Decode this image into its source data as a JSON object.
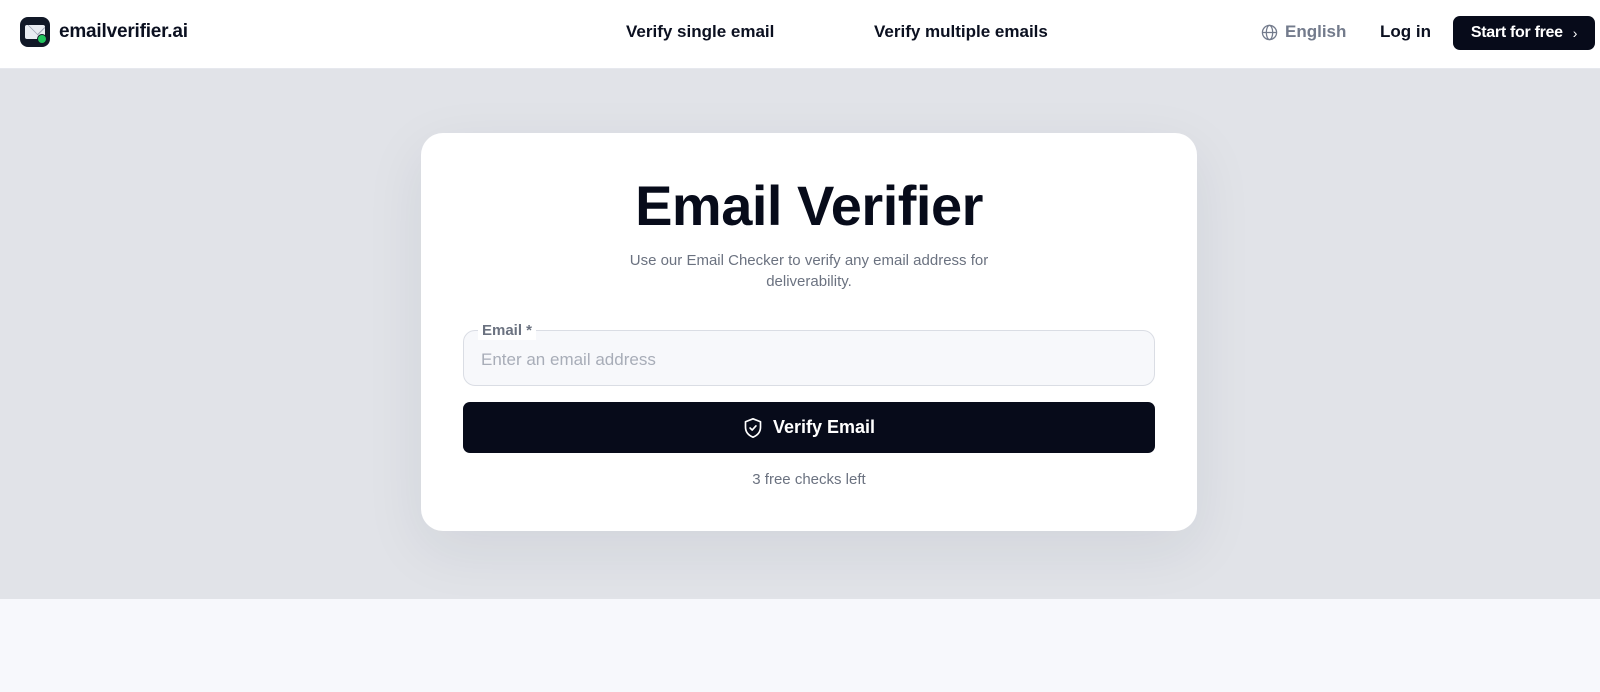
{
  "brand": {
    "name": "emailverifier.ai",
    "icon": "envelope-check-icon"
  },
  "nav": {
    "single": "Verify single email",
    "multiple": "Verify multiple emails"
  },
  "header": {
    "language": "English",
    "language_icon": "globe-icon",
    "login": "Log in",
    "cta": "Start for free",
    "cta_icon": "chevron-right-icon"
  },
  "card": {
    "title": "Email Verifier",
    "subtitle": "Use our Email Checker to verify any email address for deliverability.",
    "email_label": "Email *",
    "email_placeholder": "Enter an email address",
    "email_value": "",
    "button_label": "Verify Email",
    "button_icon": "shield-check-icon",
    "checks_left": "3 free checks left"
  },
  "colors": {
    "primary": "#070b1a",
    "hero_bg": "#e1e3e8",
    "muted_text": "#6b7280",
    "logo_accent": "#22c55e"
  }
}
